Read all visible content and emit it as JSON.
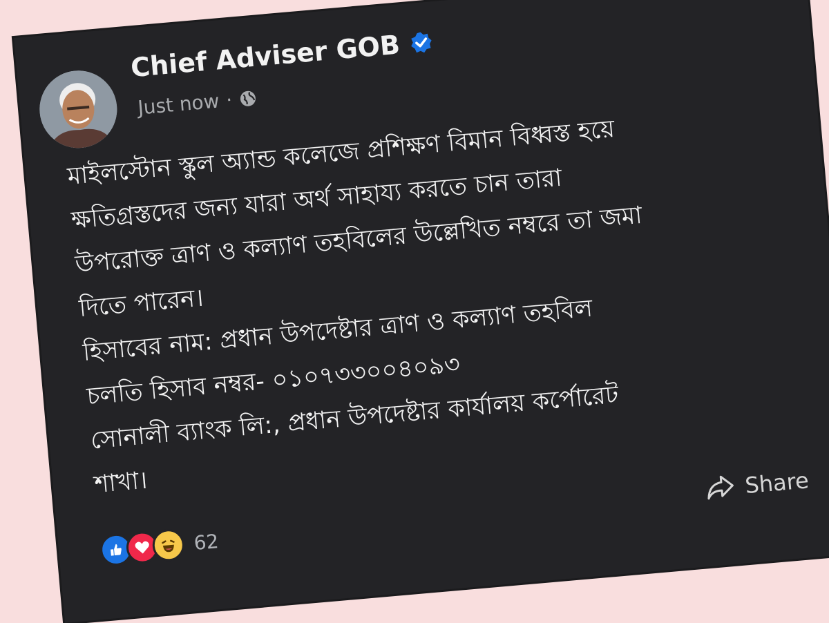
{
  "post": {
    "author": "Chief Adviser GOB",
    "time": "Just now",
    "separator": "·",
    "lines": [
      "মাইলস্টোন স্কুল অ্যান্ড কলেজে প্রশিক্ষণ বিমান বিধ্বস্ত হয়ে",
      "ক্ষতিগ্রস্তদের জন্য যারা অর্থ সাহায্য করতে চান তারা",
      "উপরোক্ত ত্রাণ ও কল্যাণ তহবিলের উল্লেখিত নম্বরে তা জমা",
      "দিতে পারেন।",
      "হিসাবের নাম: প্রধান উপদেষ্টার ত্রাণ ও কল্যাণ তহবিল",
      "চলতি হিসাব নম্বর- ০১০৭৩৩০০৪০৯৩",
      "সোনালী ব্যাংক লি:, প্রধান উপদেষ্টার কার্যালয় কর্পোরেট",
      "শাখা।"
    ],
    "reaction_count": "62",
    "share_label": "Share"
  },
  "icons": {
    "more": "more-options-icon",
    "close": "close-icon",
    "verified": "verified-badge-icon",
    "audience": "globe-icon",
    "like": "like-reaction-icon",
    "love": "love-reaction-icon",
    "haha": "haha-reaction-icon",
    "share": "share-icon"
  },
  "colors": {
    "background": "#f9dede",
    "card": "#232326",
    "text": "#f2f2f2",
    "muted": "#a9abae",
    "verified": "#1b74e4"
  }
}
